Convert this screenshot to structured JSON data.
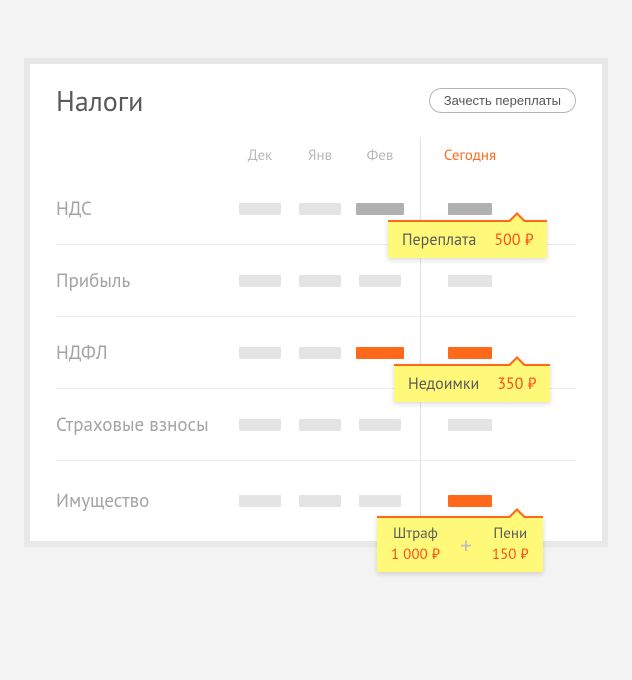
{
  "title": "Налоги",
  "offset_button": "Зачесть переплаты",
  "months": [
    "Дек",
    "Янв",
    "Фев"
  ],
  "today_label": "Сегодня",
  "rows": [
    {
      "label": "НДС"
    },
    {
      "label": "Прибыль"
    },
    {
      "label": "НДФЛ"
    },
    {
      "label": "Страховые взносы"
    },
    {
      "label": "Имущество"
    }
  ],
  "tooltips": {
    "overpay": {
      "label": "Переплата",
      "value": "500 ₽"
    },
    "arrears": {
      "label": "Недоимки",
      "value": "350 ₽"
    },
    "fine": {
      "label": "Штраф",
      "value": "1 000 ₽"
    },
    "penalty": {
      "label": "Пени",
      "value": "150 ₽"
    }
  }
}
